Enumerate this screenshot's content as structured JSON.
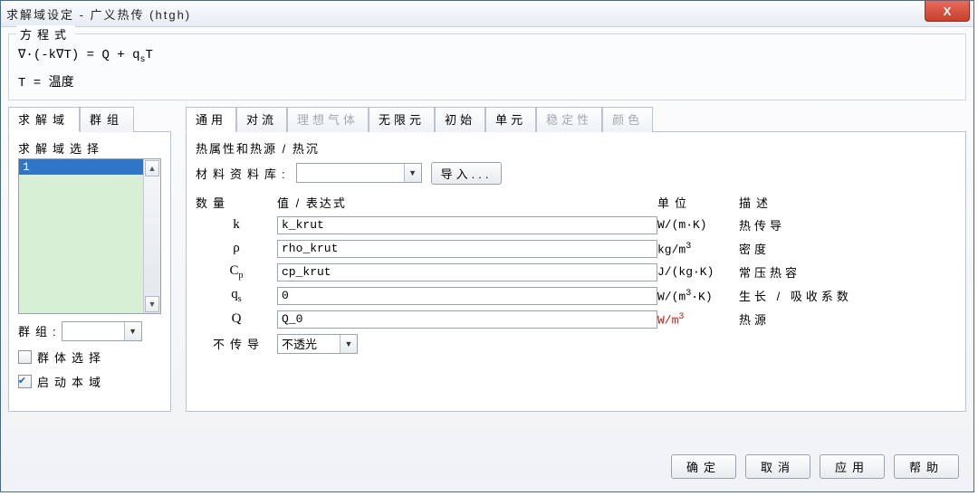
{
  "title": "求解域设定 - 广义热传 (htgh)",
  "close_glyph": "X",
  "equation_box": {
    "legend": "方程式",
    "line1_a": "∇·(-k∇T) = Q + q",
    "line1_sub": "s",
    "line1_b": "T",
    "line2": "T = 温度"
  },
  "left": {
    "tabs": [
      "求解域",
      "群组"
    ],
    "active_tab": 0,
    "select_label": "求解域选择",
    "list_items": [
      "1"
    ],
    "group_label": "群组:",
    "group_value": "",
    "chk_group_select": {
      "label": "群体选择",
      "checked": false
    },
    "chk_enable_domain": {
      "label": "启动本域",
      "checked": true
    }
  },
  "right": {
    "tabs": [
      {
        "label": "通用",
        "state": "active"
      },
      {
        "label": "对流",
        "state": "normal"
      },
      {
        "label": "理想气体",
        "state": "disabled"
      },
      {
        "label": "无限元",
        "state": "normal"
      },
      {
        "label": "初始",
        "state": "normal"
      },
      {
        "label": "单元",
        "state": "normal"
      },
      {
        "label": "稳定性",
        "state": "disabled"
      },
      {
        "label": "颜色",
        "state": "disabled"
      }
    ],
    "section_title": "热属性和热源 / 热沉",
    "mat_label": "材料资料库:",
    "mat_value": "",
    "import_label": "导入...",
    "headers": {
      "qty": "数量",
      "val": "值 / 表达式",
      "unit": "单位",
      "desc": "描述"
    },
    "rows": [
      {
        "sym_html": "k",
        "val": "k_krut",
        "unit_html": "W/(m·K)",
        "unit_red": false,
        "desc": "热传导"
      },
      {
        "sym_html": "ρ",
        "val": "rho_krut",
        "unit_html": "kg/m<span class='sup'>3</span>",
        "unit_red": false,
        "desc": "密度"
      },
      {
        "sym_html": "C<span class='sub'>p</span>",
        "val": "cp_krut",
        "unit_html": "J/(kg·K)",
        "unit_red": false,
        "desc": "常压热容"
      },
      {
        "sym_html": "q<span class='sub'>s</span>",
        "val": "0",
        "unit_html": "W/(m<span class='sup'>3</span>·K)",
        "unit_red": false,
        "desc": "生长 / 吸收系数"
      },
      {
        "sym_html": "Q",
        "val": "Q_0",
        "unit_html": "W/m<span class='sup'>3</span>",
        "unit_red": true,
        "desc": "热源"
      }
    ],
    "opaque": {
      "label": "不传导",
      "value": "不透光"
    }
  },
  "footer": [
    "确定",
    "取消",
    "应用",
    "帮助"
  ]
}
